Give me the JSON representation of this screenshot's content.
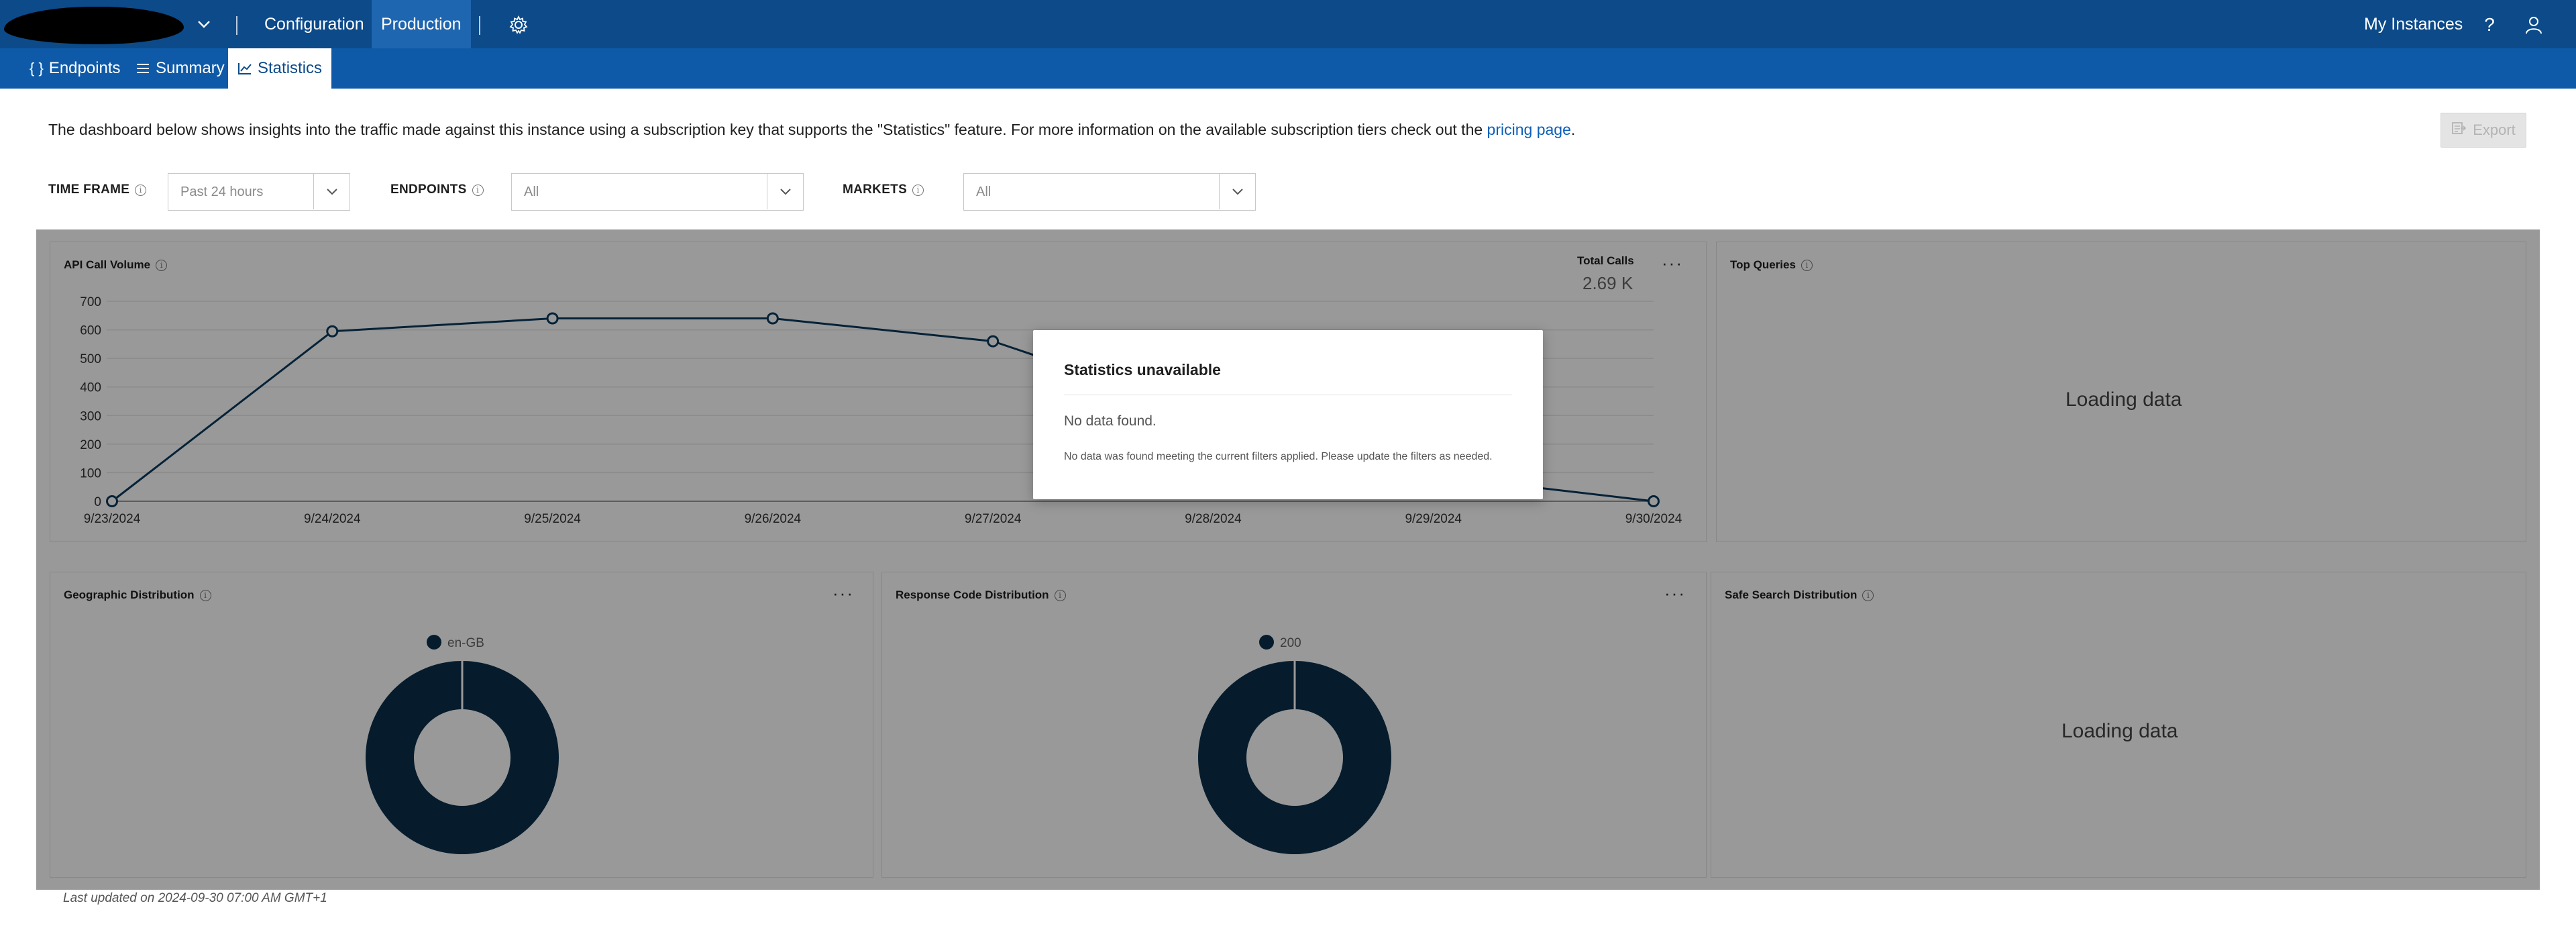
{
  "topbar": {
    "nav": [
      {
        "label": "Configuration"
      },
      {
        "label": "Production"
      }
    ],
    "my_instances": "My Instances",
    "help_glyph": "?"
  },
  "tabs": [
    {
      "label": "Endpoints",
      "icon": "braces-icon"
    },
    {
      "label": "Summary",
      "icon": "list-icon"
    },
    {
      "label": "Statistics",
      "icon": "chart-icon"
    }
  ],
  "info": {
    "text": "The dashboard below shows insights into the traffic made against this instance using a subscription key that supports the \"Statistics\" feature. For more information on the available subscription tiers check out the ",
    "link": "pricing page",
    "suffix": "."
  },
  "export_label": "Export",
  "filters": {
    "timeframe": {
      "label": "TIME FRAME",
      "value": "Past 24 hours"
    },
    "endpoints": {
      "label": "ENDPOINTS",
      "value": "All"
    },
    "markets": {
      "label": "MARKETS",
      "value": "All"
    }
  },
  "cards": {
    "api_call_volume": {
      "title": "API Call Volume",
      "total_label": "Total Calls",
      "total_value": "2.69 K"
    },
    "top_queries": {
      "title": "Top Queries",
      "loading": "Loading data"
    },
    "geographic": {
      "title": "Geographic Distribution",
      "legend": "en-GB"
    },
    "response_code": {
      "title": "Response Code Distribution",
      "legend": "200"
    },
    "safe_search": {
      "title": "Safe Search Distribution",
      "loading": "Loading data"
    }
  },
  "modal": {
    "title": "Statistics unavailable",
    "subtitle": "No data found.",
    "message": "No data was found meeting the current filters applied. Please update the filters as needed."
  },
  "footer": "Last updated on 2024-09-30 07:00 AM GMT+1",
  "chart_data": [
    {
      "type": "line",
      "title": "API Call Volume",
      "x": [
        "9/23/2024",
        "9/24/2024",
        "9/25/2024",
        "9/26/2024",
        "9/27/2024",
        "9/28/2024",
        "9/29/2024",
        "9/30/2024"
      ],
      "series": [
        {
          "values": [
            0,
            595,
            640,
            640,
            560,
            300,
            90,
            0
          ]
        }
      ],
      "yticks": [
        0,
        100,
        200,
        300,
        400,
        500,
        600,
        700
      ],
      "ylim": [
        0,
        700
      ],
      "grid": true,
      "colors": {
        "line": "#0b3a5c",
        "grid": "#e6e6e6"
      }
    },
    {
      "type": "pie",
      "title": "Geographic Distribution",
      "categories": [
        "en-GB"
      ],
      "values": [
        100
      ],
      "colors": [
        "#0b2f4a"
      ]
    },
    {
      "type": "pie",
      "title": "Response Code Distribution",
      "categories": [
        "200"
      ],
      "values": [
        100
      ],
      "colors": [
        "#0b2f4a"
      ]
    }
  ]
}
